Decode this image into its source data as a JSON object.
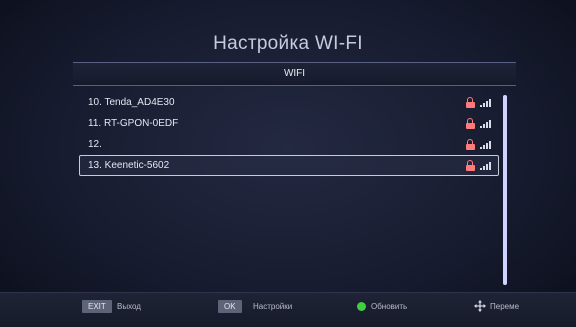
{
  "header": {
    "title": "Настройка WI-FI"
  },
  "section": {
    "label": "WIFI"
  },
  "networks": [
    {
      "label": "10.  Tenda_AD4E30",
      "locked": true,
      "signal_bars": 4
    },
    {
      "label": "11.  RT-GPON-0EDF",
      "locked": true,
      "signal_bars": 4
    },
    {
      "label": "12.",
      "locked": true,
      "signal_bars": 4
    },
    {
      "label": "13.  Keenetic-5602",
      "locked": true,
      "signal_bars": 4,
      "selected": true
    }
  ],
  "footer": {
    "exit_key": "EXIT",
    "exit_label": "Выход",
    "ok_key": "OK",
    "ok_label": "Настройки",
    "refresh_label": "Обновить",
    "move_label": "Переме"
  },
  "colors": {
    "lock": "#ff7b7b",
    "scrollbar": "#cfd3ff",
    "refresh_dot": "#3fcf3f"
  }
}
